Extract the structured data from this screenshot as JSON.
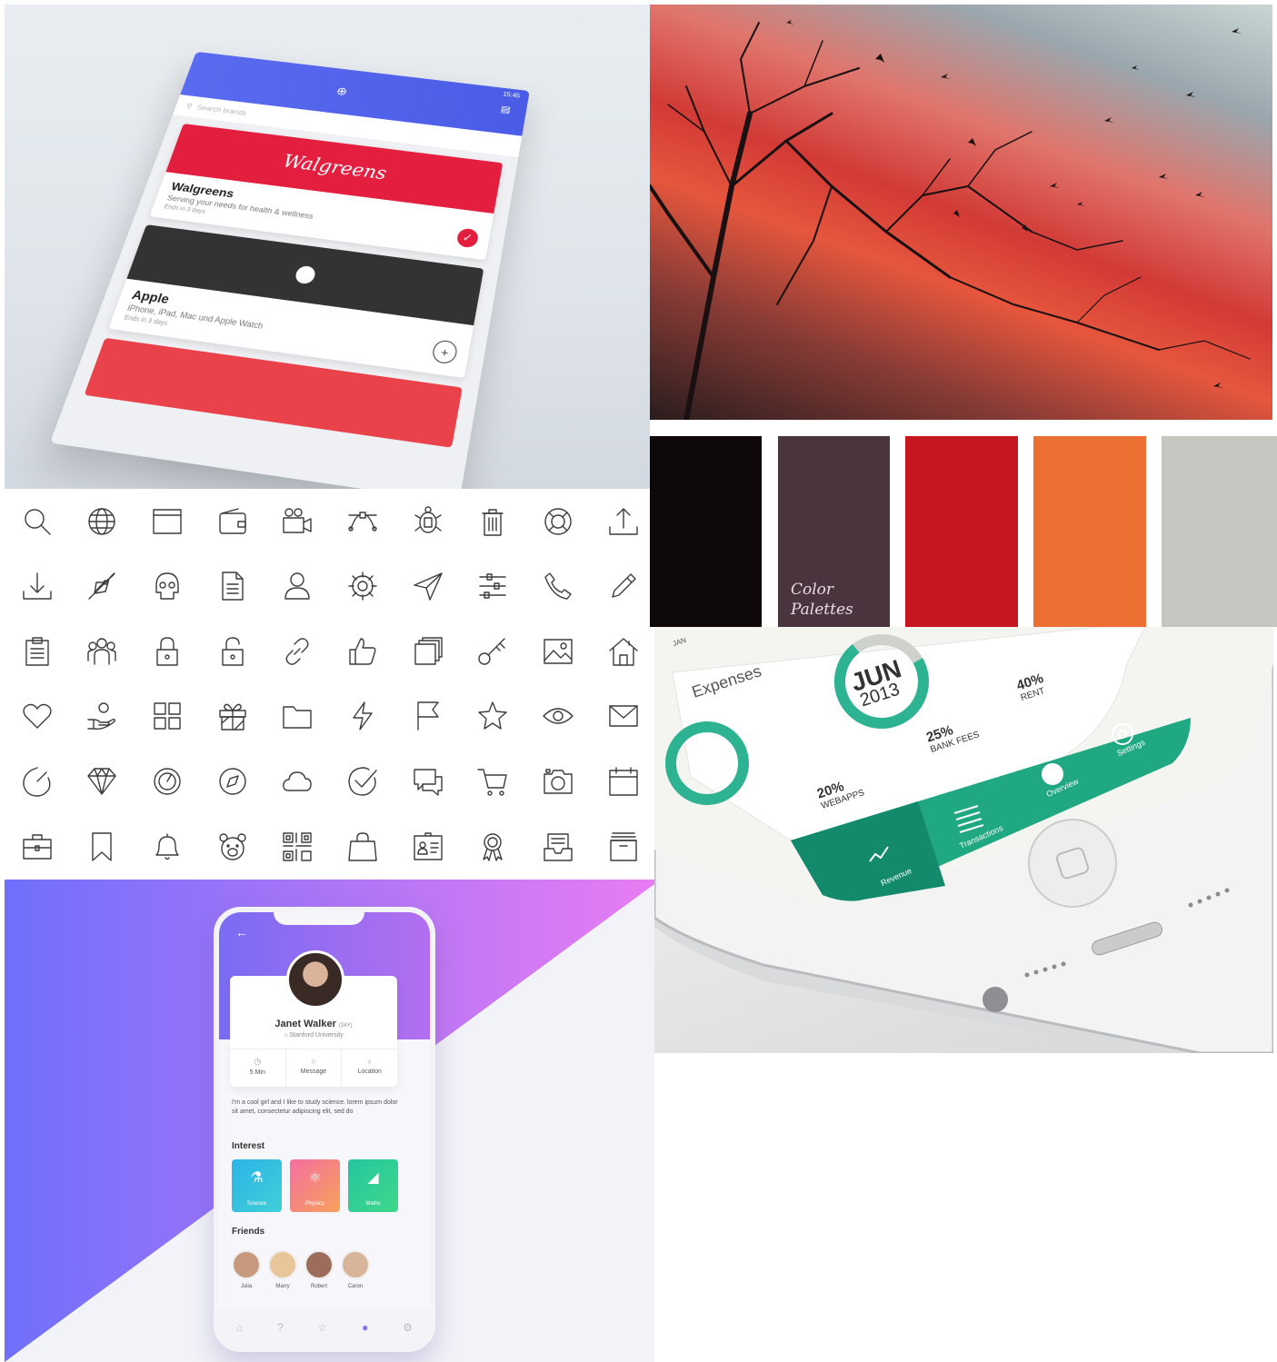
{
  "brands_app": {
    "status_time": "15:45",
    "search_placeholder": "Search brands",
    "cards": [
      {
        "hero": "Walgreens",
        "name": "Walgreens",
        "desc": "Serving your needs for health & wellness",
        "ends": "Ends in 3 days",
        "color": "#e41e3f"
      },
      {
        "hero": "",
        "name": "Apple",
        "desc": "iPhone, iPad, Mac und Apple Watch",
        "ends": "Ends in 3 days",
        "color": "#333333"
      }
    ]
  },
  "palette": {
    "label_line1": "Color",
    "label_line2": "Palettes",
    "swatches": [
      "#0f0809",
      "#4a343e",
      "#c61720",
      "#eb7032",
      "#c4c6bf"
    ]
  },
  "icon_grid": [
    [
      "search-icon",
      "globe-icon",
      "browser-window-icon",
      "wallet-icon",
      "video-camera-icon",
      "vector-path-icon",
      "turtle-icon",
      "trash-icon",
      "lifebuoy-icon",
      "upload-icon"
    ],
    [
      "download-icon",
      "rocket-icon",
      "skull-icon",
      "document-icon",
      "user-icon",
      "gear-icon",
      "send-icon",
      "sliders-icon",
      "phone-icon",
      "pencil-icon"
    ],
    [
      "clipboard-icon",
      "group-icon",
      "lock-icon",
      "unlock-icon",
      "link-icon",
      "thumbs-up-icon",
      "stack-icon",
      "key-icon",
      "image-icon",
      "house-icon"
    ],
    [
      "heart-icon",
      "hand-coin-icon",
      "grid-icon",
      "gift-icon",
      "folder-icon",
      "lightning-icon",
      "flag-icon",
      "star-icon",
      "eye-icon",
      "mail-icon"
    ],
    [
      "gauge-icon",
      "diamond-icon",
      "speedometer-icon",
      "compass-icon",
      "cloud-icon",
      "check-circle-icon",
      "chat-icon",
      "cart-icon",
      "camera-icon",
      "calendar-icon"
    ],
    [
      "briefcase-icon",
      "bookmark-icon",
      "bell-icon",
      "bear-icon",
      "qr-code-icon",
      "shopping-bag-icon",
      "id-card-icon",
      "award-icon",
      "inbox-icon",
      "archive-icon"
    ]
  ],
  "expenses_app": {
    "title": "Expenses",
    "month": "JUN",
    "year": "2013",
    "top_tab": "JAN",
    "stats": [
      {
        "pct": "40%",
        "label": "RENT"
      },
      {
        "pct": "25%",
        "label": "BANK FEES"
      },
      {
        "pct": "20%",
        "label": "WEBAPPS"
      }
    ],
    "tabs": [
      "Revenue",
      "Transactions",
      "Overview",
      "Settings"
    ],
    "accent": "#1fa882"
  },
  "profile_app": {
    "name": "Janet Walker",
    "age": "(24Y)",
    "university": "Stanford University",
    "stats": [
      {
        "icon": "clock-icon",
        "label": "5 Min"
      },
      {
        "icon": "chat-icon",
        "label": "Message"
      },
      {
        "icon": "location-pin-icon",
        "label": "Location"
      }
    ],
    "bio": "I'm a cool girl and I like to study science. lorem ipsum dolor sit amet, consectetur adipiscing elit, sed do",
    "interest_title": "Interest",
    "interests": [
      {
        "label": "Science",
        "color_from": "#2cb3e6",
        "color_to": "#3fd0d8"
      },
      {
        "label": "Physics",
        "color_from": "#f46fa0",
        "color_to": "#f7a15a"
      },
      {
        "label": "Maths",
        "color_from": "#24c6a0",
        "color_to": "#3fd88a"
      }
    ],
    "friends_title": "Friends",
    "friends": [
      "Julia",
      "Marry",
      "Robert",
      "Caron"
    ],
    "gradient_from": "#6f6ffb",
    "gradient_to": "#e87cf2"
  }
}
